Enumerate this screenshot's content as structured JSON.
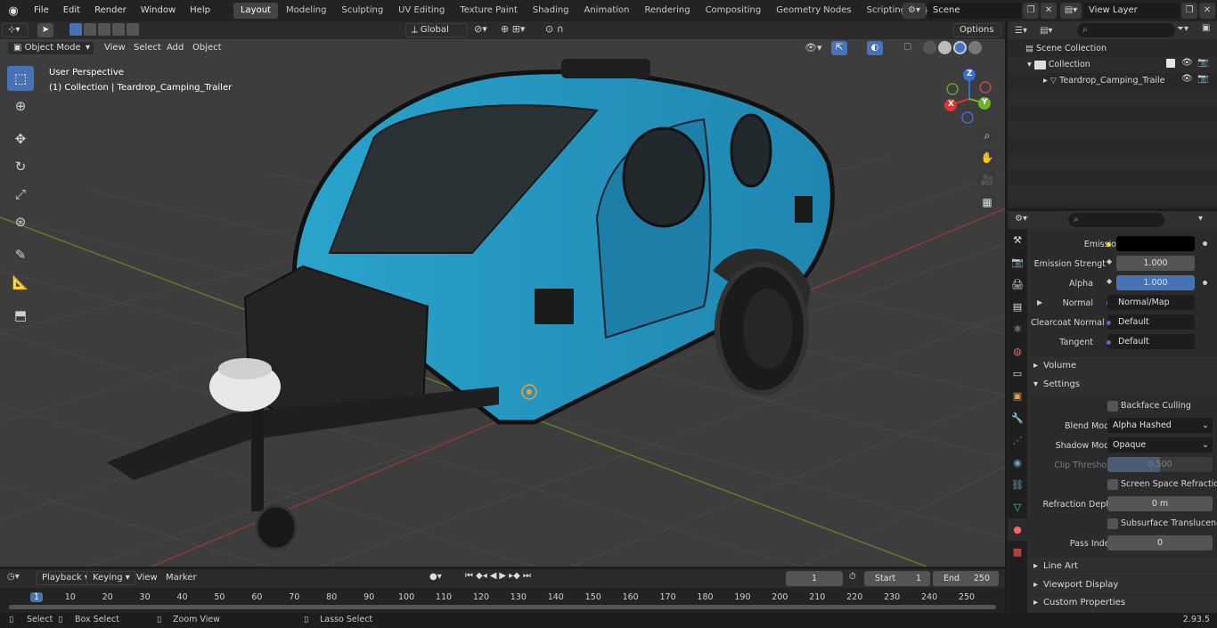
{
  "topbar": {
    "menus": [
      "File",
      "Edit",
      "Render",
      "Window",
      "Help"
    ],
    "workspaces": [
      "Layout",
      "Modeling",
      "Sculpting",
      "UV Editing",
      "Texture Paint",
      "Shading",
      "Animation",
      "Rendering",
      "Compositing",
      "Geometry Nodes",
      "Scripting"
    ],
    "active_workspace": "Layout",
    "scene": "Scene",
    "view_layer": "View Layer"
  },
  "viewport_header": {
    "transform_orientation": "Global",
    "options_label": "Options"
  },
  "viewport_menu": {
    "mode": "Object Mode",
    "items": [
      "View",
      "Select",
      "Add",
      "Object"
    ]
  },
  "viewport_overlay": {
    "perspective": "User Perspective",
    "collection": "(1) Collection | Teardrop_Camping_Trailer"
  },
  "gizmo": {
    "x": "X",
    "y": "Y",
    "z": "Z"
  },
  "outliner": {
    "scene_collection": "Scene Collection",
    "collection": "Collection",
    "object": "Teardrop_Camping_Traile"
  },
  "properties": {
    "emission_label": "Emission",
    "emission_strength_label": "Emission Strengt",
    "emission_strength": "1.000",
    "alpha_label": "Alpha",
    "alpha": "1.000",
    "normal_label": "Normal",
    "normal_value": "Normal/Map",
    "clearcoat_label": "Clearcoat Normal",
    "clearcoat_value": "Default",
    "tangent_label": "Tangent",
    "tangent_value": "Default",
    "volume_section": "Volume",
    "settings_section": "Settings",
    "backface_culling": "Backface Culling",
    "blend_mode_label": "Blend Mode",
    "blend_mode": "Alpha Hashed",
    "shadow_mode_label": "Shadow Mode",
    "shadow_mode": "Opaque",
    "clip_threshold_label": "Clip Threshold",
    "clip_threshold": "0.500",
    "screen_space_refraction": "Screen Space Refraction",
    "refraction_depth_label": "Refraction Depth",
    "refraction_depth": "0 m",
    "subsurface_translucency": "Subsurface Translucency",
    "pass_index_label": "Pass Index",
    "pass_index": "0",
    "line_art_section": "Line Art",
    "viewport_display_section": "Viewport Display",
    "custom_properties_section": "Custom Properties"
  },
  "timeline": {
    "menus": [
      "Playback",
      "Keying",
      "View",
      "Marker"
    ],
    "current_frame": "1",
    "start_label": "Start",
    "start": "1",
    "end_label": "End",
    "end": "250",
    "ruler": [
      "1",
      "10",
      "20",
      "30",
      "40",
      "50",
      "60",
      "70",
      "80",
      "90",
      "100",
      "110",
      "120",
      "130",
      "140",
      "150",
      "160",
      "170",
      "180",
      "190",
      "200",
      "210",
      "220",
      "230",
      "240",
      "250"
    ]
  },
  "statusbar": {
    "select": "Select",
    "box_select": "Box Select",
    "zoom_view": "Zoom View",
    "lasso_select": "Lasso Select",
    "version": "2.93.5"
  },
  "colors": {
    "accent": "#4772b3",
    "trailer_blue": "#2fa8cf",
    "grid_red": "#8a3a3a",
    "grid_green": "#5c7d2a"
  }
}
